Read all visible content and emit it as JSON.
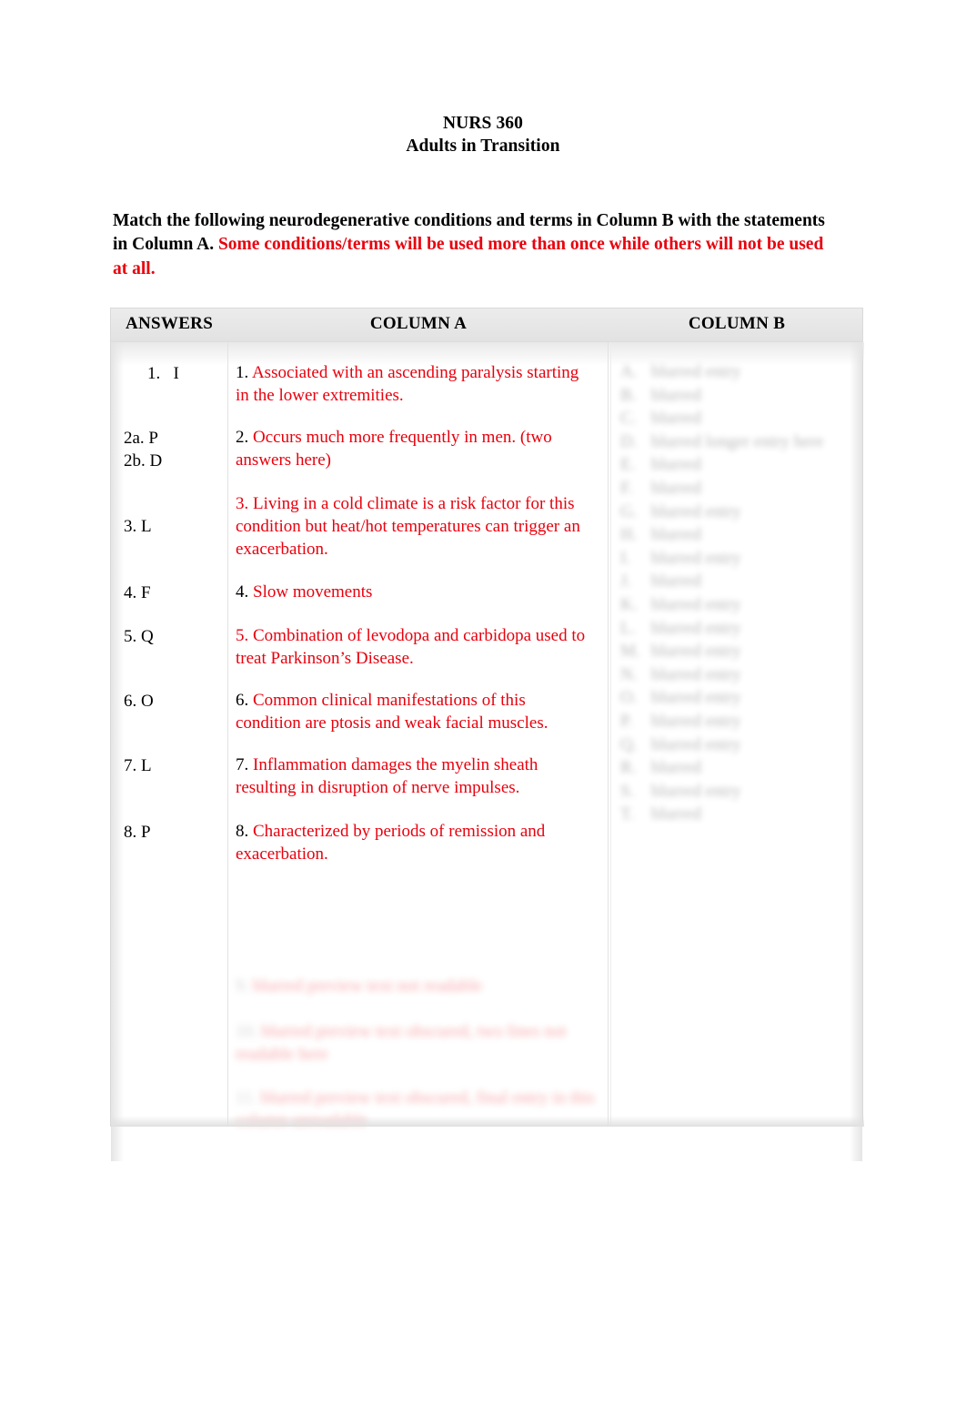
{
  "document": {
    "title_lines": [
      "NURS 360",
      "Adults in Transition"
    ],
    "instructions": {
      "black_part": "Match the following neurodegenerative conditions and terms in Column B with the statements in Column A.",
      "red_part": "Some conditions/terms will be used more than once while others will not be used at all."
    }
  },
  "colors": {
    "red": "#e8000d",
    "black": "#000000",
    "header_bg": "#e8e8e8",
    "border": "#d9d9d9"
  },
  "table": {
    "headers": {
      "answers": "ANSWERS",
      "column_a": "COLUMN A",
      "column_b": "COLUMN B"
    },
    "answers": [
      "1.   I",
      "2a. P",
      "2b. D",
      "3. L",
      "4. F",
      "5. Q",
      "6. O",
      "7. L",
      "8. P"
    ],
    "column_a": [
      {
        "num": "1.",
        "text": "Associated with an ascending paralysis starting in the lower extremities."
      },
      {
        "num": "2.",
        "text": "Occurs much more frequently in men. (two answers here)"
      },
      {
        "num": "3.",
        "text": "Living in a cold climate is a risk factor for this condition but heat/hot temperatures can trigger an exacerbation."
      },
      {
        "num": "4.",
        "text": "Slow movements"
      },
      {
        "num": "5.",
        "text": "Combination of levodopa and carbidopa used to treat Parkinson’s Disease."
      },
      {
        "num": "6.",
        "text": "Common clinical manifestations of this condition are ptosis and weak facial muscles."
      },
      {
        "num": "7.",
        "text": "Inflammation damages the myelin sheath resulting in disruption of nerve impulses."
      },
      {
        "num": "8.",
        "text": "Characterized by periods of remission and exacerbation."
      }
    ],
    "column_a_obscured": [
      {
        "num": "9.",
        "text": "blurred preview text not readable"
      },
      {
        "num": "10.",
        "text": "blurred preview text obscured, two lines not readable here"
      },
      {
        "num": "11.",
        "text": "blurred preview text obscured, final entry in this column unreadable"
      }
    ],
    "column_b_obscured": [
      {
        "label": "A.",
        "text": "blurred entry"
      },
      {
        "label": "B.",
        "text": "blurred"
      },
      {
        "label": "C.",
        "text": "blurred"
      },
      {
        "label": "D.",
        "text": "blurred longer entry here"
      },
      {
        "label": "E.",
        "text": "blurred"
      },
      {
        "label": "F.",
        "text": "blurred"
      },
      {
        "label": "G.",
        "text": "blurred entry"
      },
      {
        "label": "H.",
        "text": "blurred"
      },
      {
        "label": "I.",
        "text": "blurred entry"
      },
      {
        "label": "J.",
        "text": "blurred"
      },
      {
        "label": "K.",
        "text": "blurred entry"
      },
      {
        "label": "L.",
        "text": "blurred entry"
      },
      {
        "label": "M.",
        "text": "blurred entry"
      },
      {
        "label": "N.",
        "text": "blurred entry"
      },
      {
        "label": "O.",
        "text": "blurred entry"
      },
      {
        "label": "P.",
        "text": "blurred entry"
      },
      {
        "label": "Q.",
        "text": "blurred entry"
      },
      {
        "label": "R.",
        "text": "blurred"
      },
      {
        "label": "S.",
        "text": "blurred entry"
      },
      {
        "label": "T.",
        "text": "blurred"
      }
    ]
  }
}
